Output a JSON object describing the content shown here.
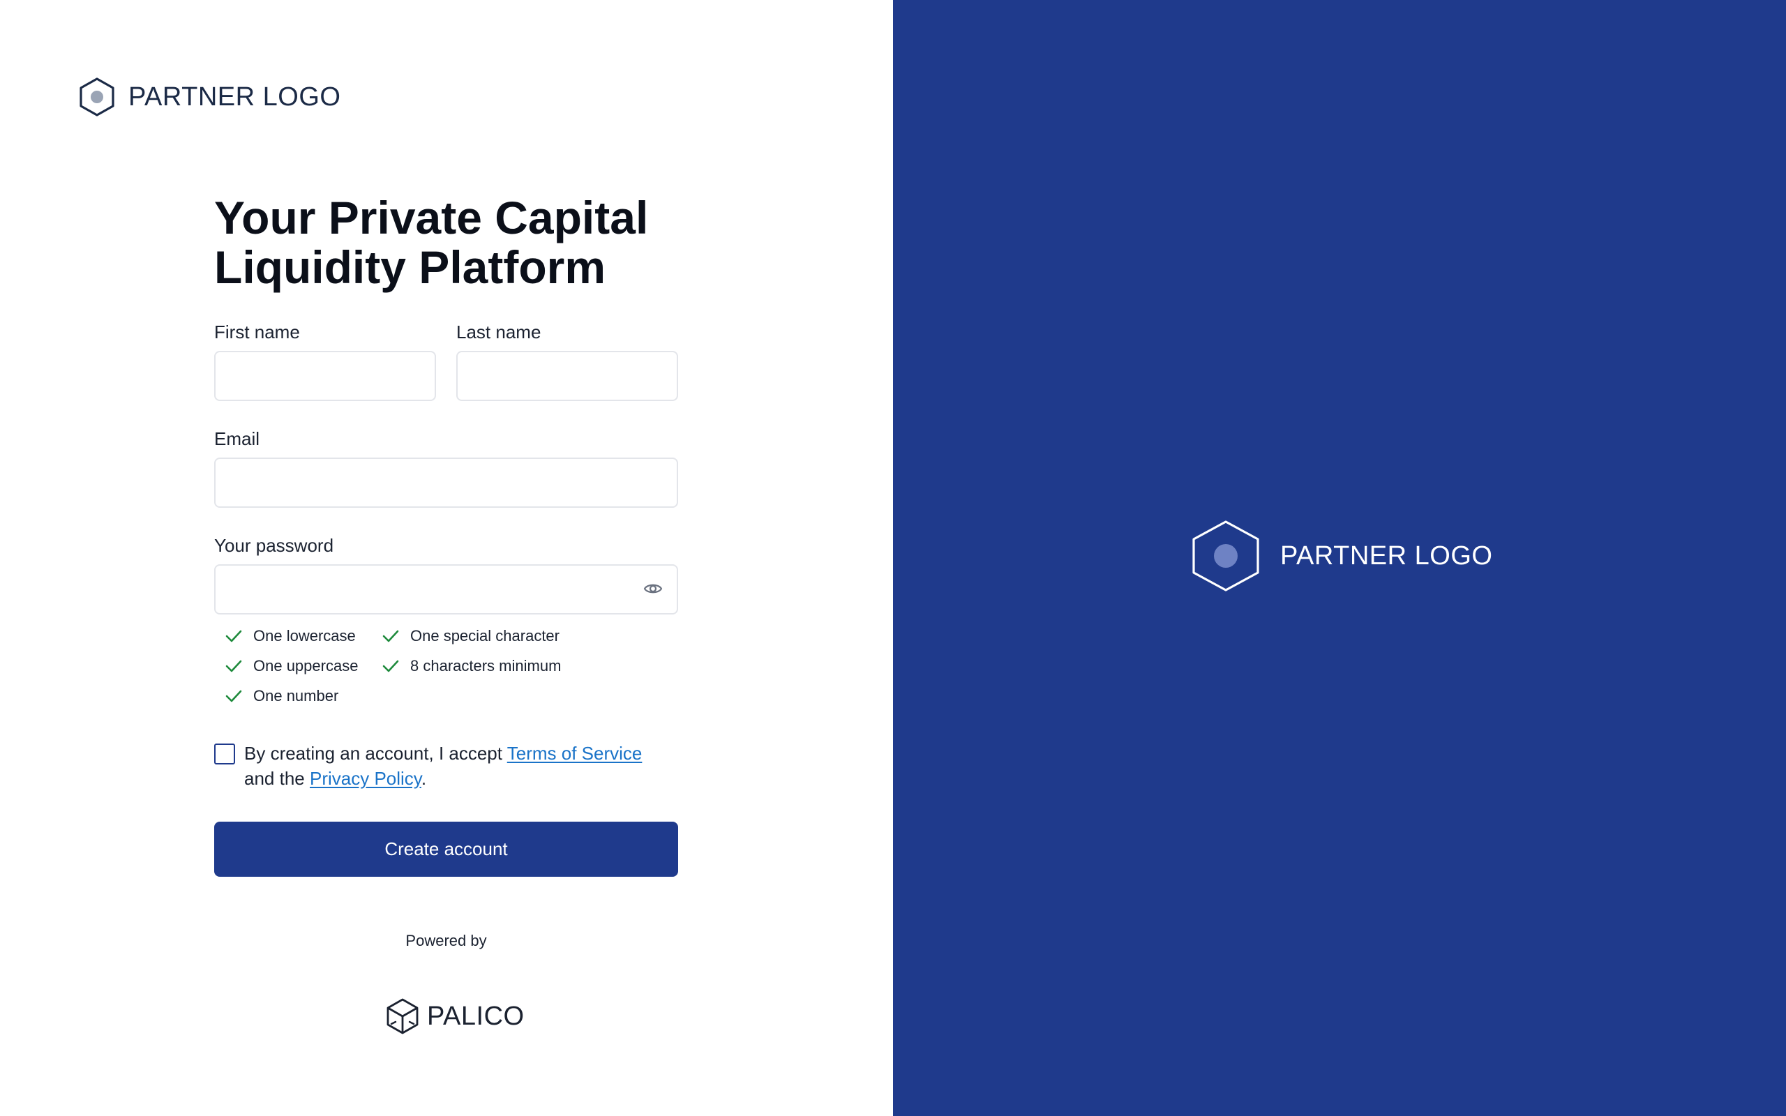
{
  "header": {
    "logo_text": "PARTNER LOGO",
    "logo_icon": "hexagon-icon"
  },
  "form": {
    "title_line1": "Your Private Capital",
    "title_line2": "Liquidity Platform",
    "first_name": {
      "label": "First name",
      "value": "",
      "placeholder": ""
    },
    "last_name": {
      "label": "Last name",
      "value": "",
      "placeholder": ""
    },
    "email": {
      "label": "Email",
      "value": "",
      "placeholder": ""
    },
    "password": {
      "label": "Your password",
      "value": "",
      "placeholder": "",
      "toggle_icon": "eye-icon"
    },
    "password_rules": [
      {
        "text": "One lowercase",
        "met": true
      },
      {
        "text": "One special character",
        "met": true
      },
      {
        "text": "One uppercase",
        "met": true
      },
      {
        "text": "8 characters minimum",
        "met": true
      },
      {
        "text": "One number",
        "met": true
      }
    ],
    "consent": {
      "checked": false,
      "prefix": "By creating an account, I accept ",
      "terms_link": "Terms of Service",
      "middle": "and the ",
      "privacy_link": "Privacy Policy",
      "suffix": "."
    },
    "submit_label": "Create account"
  },
  "footer": {
    "powered_by": "Powered by",
    "brand": "PALICO",
    "brand_icon": "cube-icon"
  },
  "side_panel": {
    "logo_text": "PARTNER LOGO",
    "logo_icon": "hexagon-icon"
  },
  "colors": {
    "brand_navy": "#1f3a8c",
    "link": "#1a73c8",
    "check_green": "#1e8a3c"
  }
}
